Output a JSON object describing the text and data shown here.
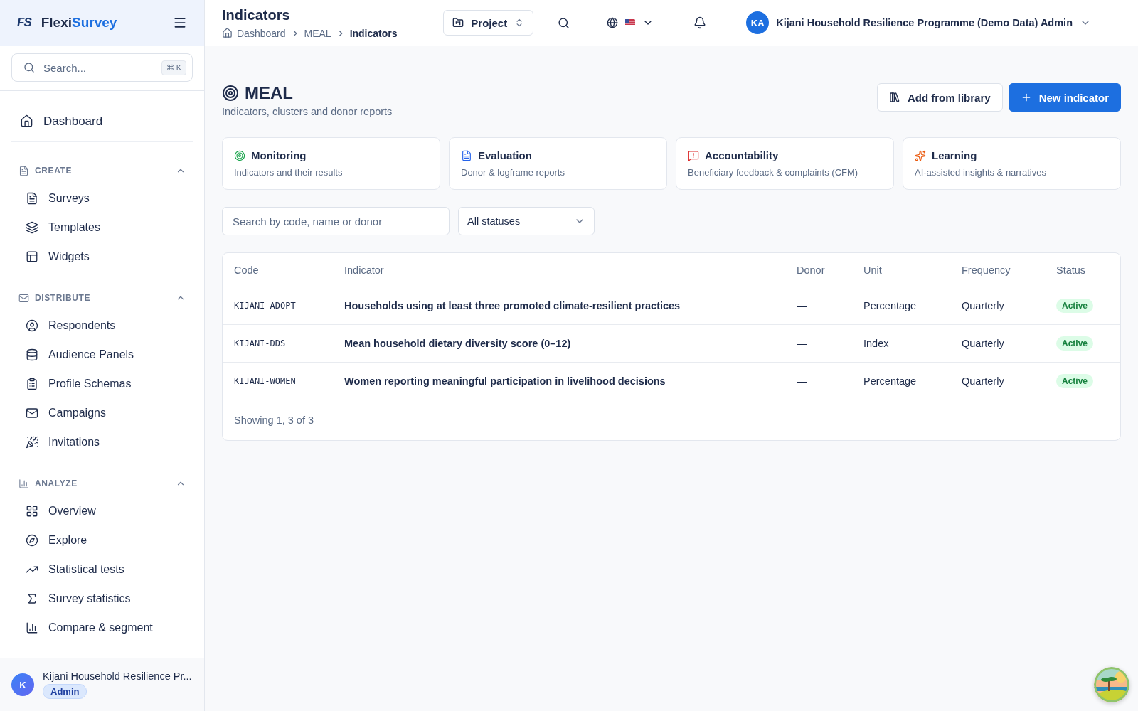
{
  "sidebar": {
    "logo": {
      "mark": "FS",
      "name_part_1": "Flexi",
      "name_part_2": "Survey"
    },
    "search": {
      "placeholder": "Search...",
      "shortcut": "⌘ K"
    },
    "top_item": {
      "label": "Dashboard"
    },
    "sections": [
      {
        "title": "CREATE",
        "expanded": true,
        "items": [
          {
            "label": "Surveys"
          },
          {
            "label": "Templates"
          },
          {
            "label": "Widgets"
          }
        ]
      },
      {
        "title": "DISTRIBUTE",
        "expanded": true,
        "items": [
          {
            "label": "Respondents"
          },
          {
            "label": "Audience Panels"
          },
          {
            "label": "Profile Schemas"
          },
          {
            "label": "Campaigns"
          },
          {
            "label": "Invitations"
          }
        ]
      },
      {
        "title": "ANALYZE",
        "expanded": true,
        "items": [
          {
            "label": "Overview"
          },
          {
            "label": "Explore"
          },
          {
            "label": "Statistical tests"
          },
          {
            "label": "Survey statistics"
          },
          {
            "label": "Compare & segment"
          }
        ]
      }
    ],
    "user": {
      "initial": "K",
      "name": "Kijani Household Resilience Pr...",
      "role": "Admin"
    }
  },
  "header": {
    "title": "Indicators",
    "breadcrumb": [
      "Dashboard",
      "MEAL",
      "Indicators"
    ],
    "project_button": "Project",
    "user": {
      "initials": "KA",
      "name": "Kijani Household Resilience Programme (Demo Data) Admin"
    }
  },
  "page": {
    "title": "MEAL",
    "subtitle": "Indicators, clusters and donor reports",
    "buttons": [
      {
        "label": "Add from library",
        "kind": "secondary"
      },
      {
        "label": "New indicator",
        "kind": "primary"
      }
    ],
    "cards": [
      {
        "title": "Monitoring",
        "description": "Indicators and their results"
      },
      {
        "title": "Evaluation",
        "description": "Donor & logframe reports"
      },
      {
        "title": "Accountability",
        "description": "Beneficiary feedback & complaints (CFM)"
      },
      {
        "title": "Learning",
        "description": "AI-assisted insights & narratives"
      }
    ],
    "search": {
      "placeholder": "Search by code, name or donor"
    },
    "status_filter": {
      "value": "All statuses"
    },
    "table": {
      "columns": [
        "Code",
        "Indicator",
        "Donor",
        "Unit",
        "Frequency",
        "Status"
      ],
      "rows": [
        {
          "code": "KIJANI-ADOPT",
          "indicator": "Households using at least three promoted climate-resilient practices",
          "donor": "—",
          "unit": "Percentage",
          "frequency": "Quarterly",
          "status": "Active"
        },
        {
          "code": "KIJANI-DDS",
          "indicator": "Mean household dietary diversity score (0–12)",
          "donor": "—",
          "unit": "Index",
          "frequency": "Quarterly",
          "status": "Active"
        },
        {
          "code": "KIJANI-WOMEN",
          "indicator": "Women reporting meaningful participation in livelihood decisions",
          "donor": "—",
          "unit": "Percentage",
          "frequency": "Quarterly",
          "status": "Active"
        }
      ],
      "footer": "Showing 1, 3 of 3"
    }
  }
}
